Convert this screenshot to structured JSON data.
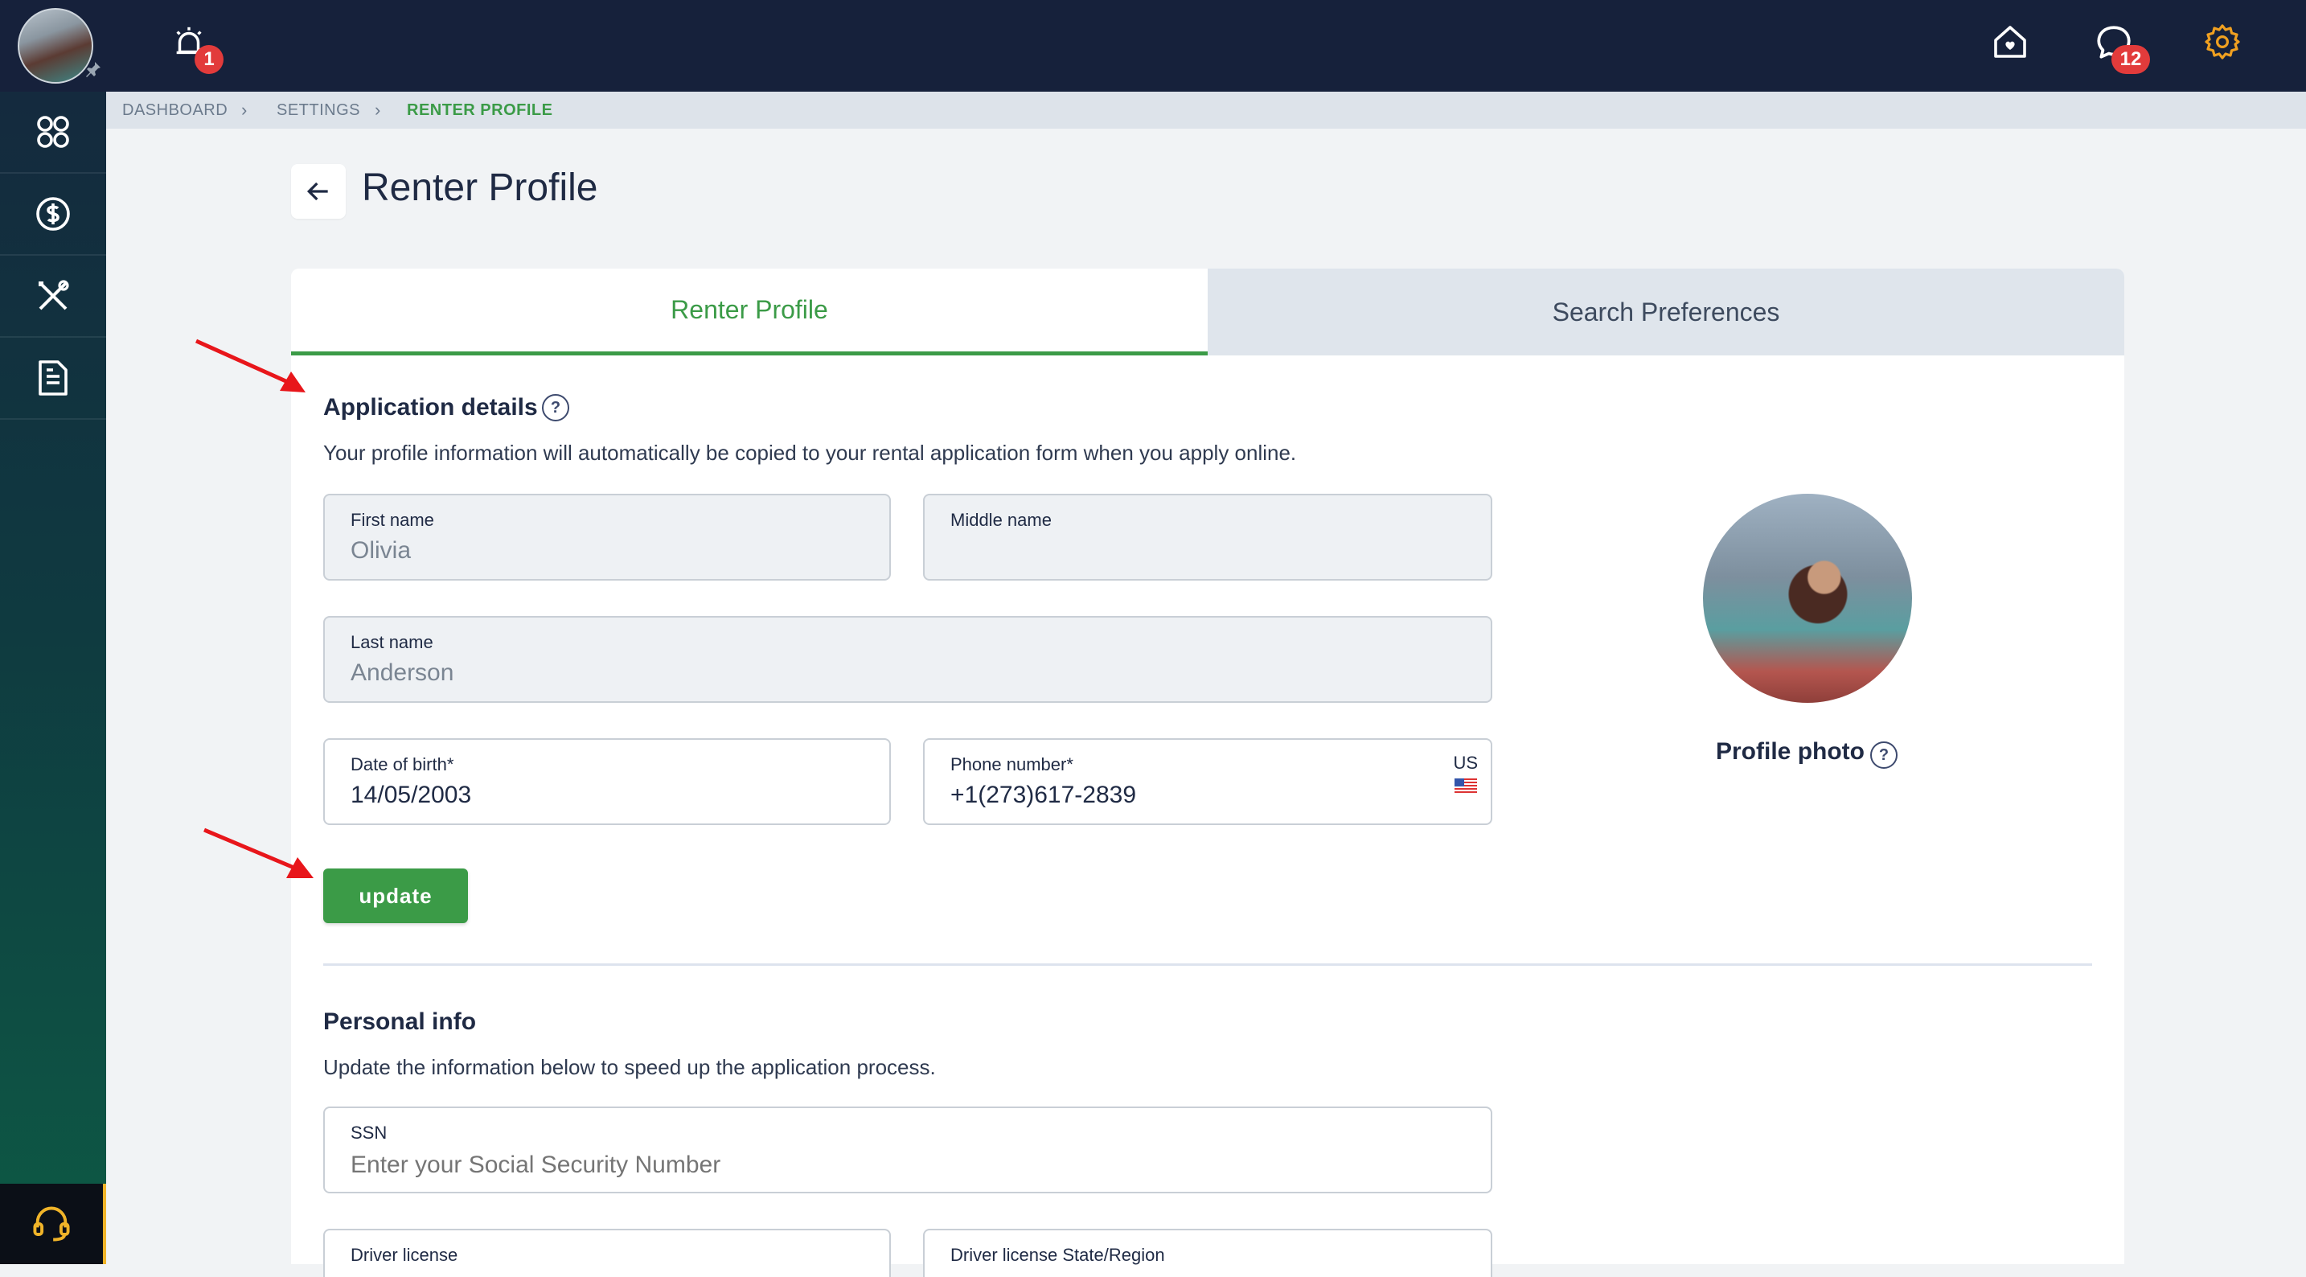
{
  "topbar": {
    "alarm_badge": "1",
    "messages_badge": "12"
  },
  "breadcrumb": [
    "DASHBOARD",
    "SETTINGS",
    "RENTER PROFILE"
  ],
  "page": {
    "title": "Renter Profile"
  },
  "tabs": [
    {
      "label": "Renter Profile",
      "active": true
    },
    {
      "label": "Search Preferences",
      "active": false
    }
  ],
  "application_details": {
    "title": "Application details",
    "description": "Your profile information will automatically be copied to your rental application form when you apply online.",
    "first_name": {
      "label": "First name",
      "value": "Olivia"
    },
    "middle_name": {
      "label": "Middle name",
      "value": ""
    },
    "last_name": {
      "label": "Last name",
      "value": "Anderson"
    },
    "date_of_birth": {
      "label": "Date of birth*",
      "value": "14/05/2003"
    },
    "phone_number": {
      "label": "Phone number*",
      "value": "+1(273)617-2839",
      "country": "US"
    },
    "update_label": "update"
  },
  "profile_photo": {
    "label": "Profile photo"
  },
  "personal_info": {
    "title": "Personal info",
    "description": "Update the information below to speed up the application process.",
    "ssn": {
      "label": "SSN",
      "placeholder": "Enter your Social Security Number"
    },
    "driver_license": {
      "label": "Driver license"
    },
    "driver_license_state": {
      "label": "Driver license State/Region"
    }
  },
  "colors": {
    "accent": "#3b9b47",
    "topbar": "#16213b",
    "badge": "#e23b3b",
    "settings_icon": "#f0a020"
  }
}
